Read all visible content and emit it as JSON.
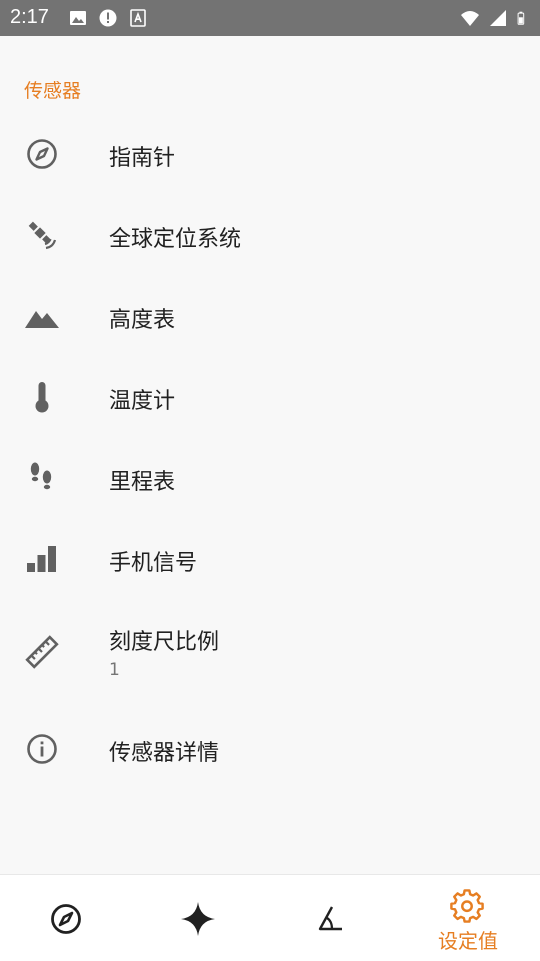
{
  "status_bar": {
    "time": "2:17",
    "left_icons": [
      "image-icon",
      "alert-icon",
      "text-icon"
    ],
    "right_icons": [
      "wifi-icon",
      "signal-icon",
      "battery-icon"
    ]
  },
  "settings": {
    "section_title": "传感器",
    "items": [
      {
        "label": "指南针",
        "icon": "compass-icon"
      },
      {
        "label": "全球定位系统",
        "icon": "satellite-icon"
      },
      {
        "label": "高度表",
        "icon": "mountain-icon"
      },
      {
        "label": "温度计",
        "icon": "thermometer-icon"
      },
      {
        "label": "里程表",
        "icon": "footsteps-icon"
      },
      {
        "label": "手机信号",
        "icon": "signal-bars-icon"
      },
      {
        "label": "刻度尺比例",
        "summary": "1",
        "icon": "ruler-icon"
      },
      {
        "label": "传感器详情",
        "icon": "info-icon"
      }
    ]
  },
  "bottom_nav": {
    "items": [
      {
        "icon": "compass-icon",
        "label": ""
      },
      {
        "icon": "star-icon",
        "label": ""
      },
      {
        "icon": "angle-icon",
        "label": ""
      },
      {
        "icon": "gear-icon",
        "label": "设定值",
        "active": true
      }
    ]
  },
  "colors": {
    "accent": "#e67e22",
    "status_bar": "#737373",
    "icon": "#616161",
    "background": "#f8f8f8"
  }
}
